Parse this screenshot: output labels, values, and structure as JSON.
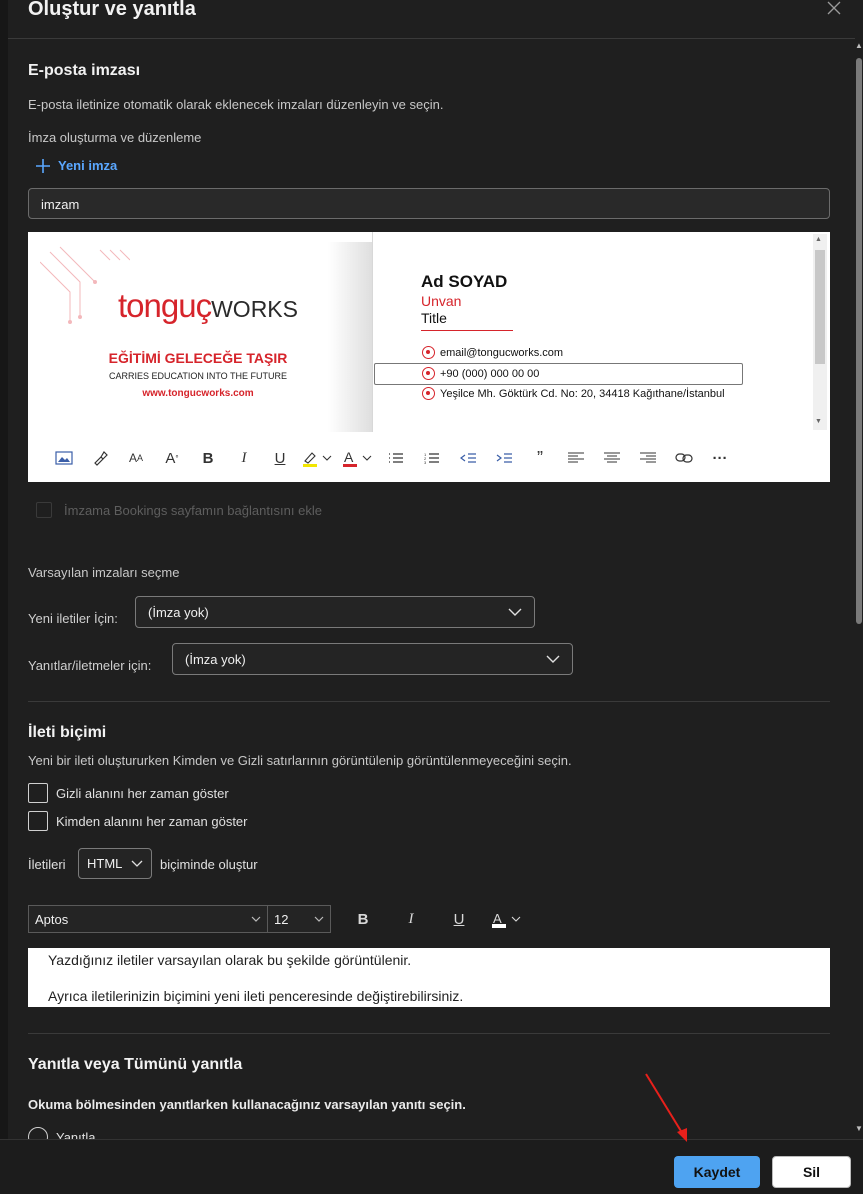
{
  "dialog": {
    "title": "Oluştur ve yanıtla"
  },
  "signature": {
    "heading": "E-posta imzası",
    "description": "E-posta iletinize otomatik olarak eklenecek imzaları düzenleyin ve seçin.",
    "create_label": "İmza oluşturma ve düzenleme",
    "new_label": "Yeni imza",
    "name_value": "imzam",
    "content": {
      "logo_main": "tonguç",
      "logo_works": "WORKS",
      "slogan_tr": "EĞİTİMİ GELECEĞE TAŞIR",
      "slogan_en": "CARRIES EDUCATION INTO THE FUTURE",
      "website": "www.tongucworks.com",
      "name": "Ad SOYAD",
      "unvan": "Unvan",
      "title": "Title",
      "email": "email@tongucworks.com",
      "phone": "+90 (000) 000 00 00",
      "address": "Yeşilce Mh. Göktürk Cd. No: 20, 34418 Kağıthane/İstanbul"
    },
    "bookings_label": "İmzama Bookings sayfamın bağlantısını ekle"
  },
  "defaults": {
    "heading": "Varsayılan imzaları seçme",
    "new_messages_label": "Yeni iletiler İçin:",
    "new_messages_value": "(İmza yok)",
    "replies_label": "Yanıtlar/iletmeler için:",
    "replies_value": "(İmza yok)"
  },
  "format": {
    "heading": "İleti biçimi",
    "description": "Yeni bir ileti oluştururken Kimden ve Gizli satırlarının görüntülenip görüntülenmeyeceğini seçin.",
    "show_bcc": "Gizli alanını her zaman göster",
    "show_from": "Kimden alanını her zaman göster",
    "compose_prefix": "İletileri",
    "compose_value": "HTML",
    "compose_suffix": "biçiminde oluştur",
    "font_name": "Aptos",
    "font_size": "12",
    "preview_line1": "Yazdığınız iletiler varsayılan olarak bu şekilde görüntülenir.",
    "preview_line2": "Ayrıca iletilerinizin biçimini yeni ileti penceresinde değiştirebilirsiniz."
  },
  "reply": {
    "heading": "Yanıtla veya Tümünü yanıtla",
    "description": "Okuma bölmesinden yanıtlarken kullanacağınız varsayılan yanıtı seçin.",
    "option1": "Yanıtla"
  },
  "footer": {
    "save_label": "Kaydet",
    "delete_label": "Sil"
  },
  "colors": {
    "accent": "#4ea3f1",
    "brand_red": "#d6242b",
    "background": "#1f1f1f"
  }
}
